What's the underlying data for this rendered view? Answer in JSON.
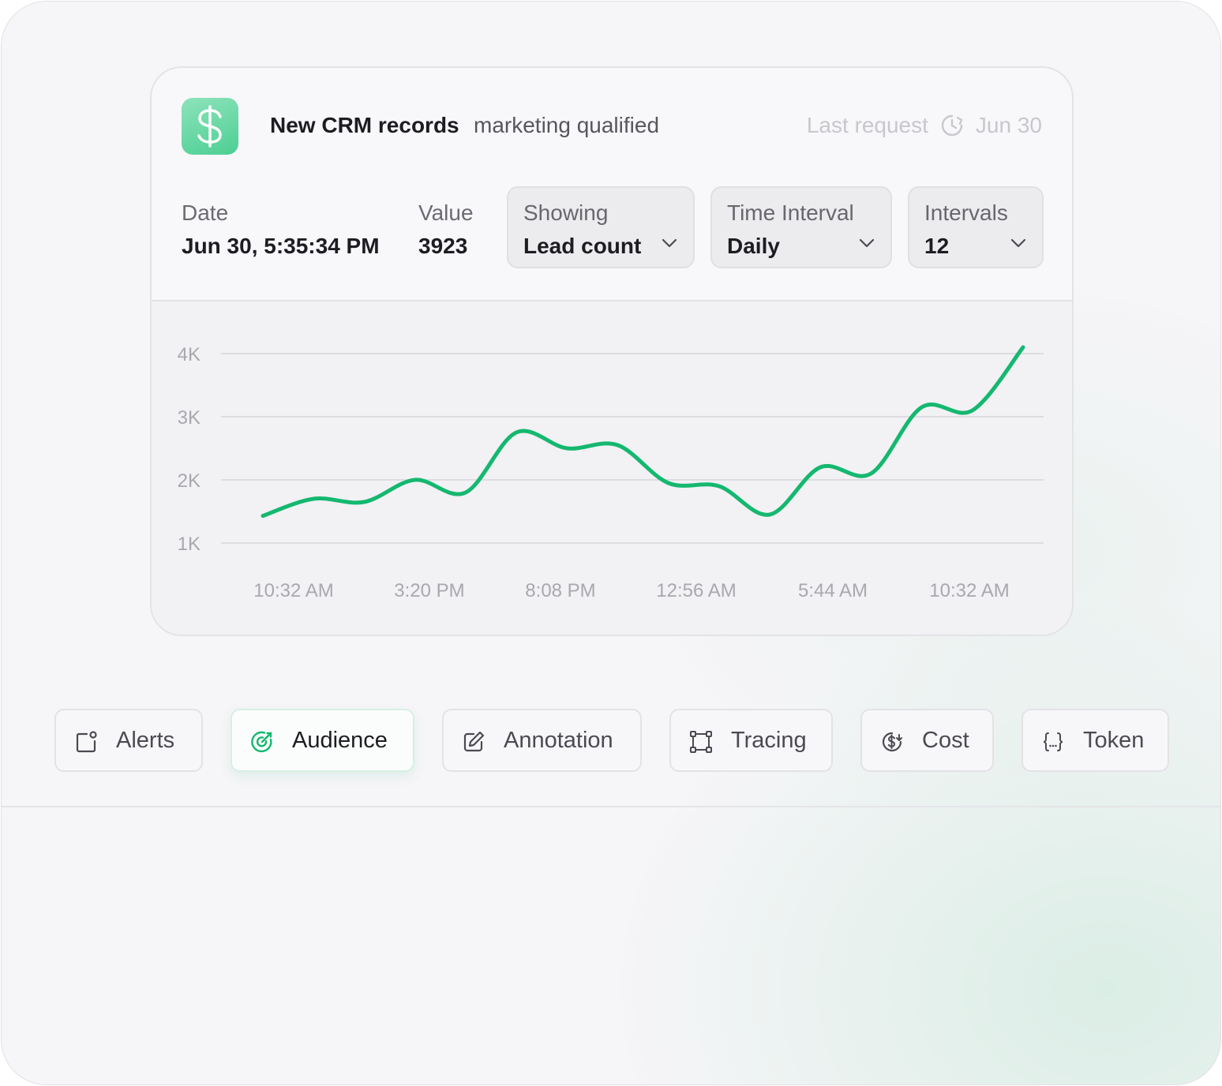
{
  "card": {
    "title": "New CRM records",
    "subtitle": "marketing qualified",
    "last_request_label": "Last request",
    "last_request_value": "Jun 30",
    "date_label": "Date",
    "date_value": "Jun 30, 5:35:34 PM",
    "value_label": "Value",
    "value_value": "3923",
    "selectors": [
      {
        "label": "Showing",
        "value": "Lead count"
      },
      {
        "label": "Time Interval",
        "value": "Daily"
      },
      {
        "label": "Intervals",
        "value": "12"
      }
    ],
    "accent_color": "#14b86f"
  },
  "chart_data": {
    "type": "line",
    "y_tick_labels": [
      "4K",
      "3K",
      "2K",
      "1K"
    ],
    "x_tick_labels": [
      "10:32 AM",
      "3:20 PM",
      "8:08 PM",
      "12:56 AM",
      "5:44 AM",
      "10:32 AM"
    ],
    "ylim": [
      1000,
      4000
    ],
    "grid": true,
    "series": [
      {
        "values": [
          1430,
          1700,
          1650,
          2000,
          1800,
          2750,
          2500,
          2550,
          1950,
          1900,
          1450,
          2200,
          2100,
          3150,
          3100,
          4100
        ]
      }
    ]
  },
  "tabs": [
    {
      "label": "Alerts",
      "icon": "alert-bell-icon",
      "active": false
    },
    {
      "label": "Audience",
      "icon": "target-icon",
      "active": true
    },
    {
      "label": "Annotation",
      "icon": "edit-icon",
      "active": false
    },
    {
      "label": "Tracing",
      "icon": "trace-nodes-icon",
      "active": false
    },
    {
      "label": "Cost",
      "icon": "cost-icon",
      "active": false
    },
    {
      "label": "Token",
      "icon": "braces-icon",
      "active": false
    }
  ]
}
